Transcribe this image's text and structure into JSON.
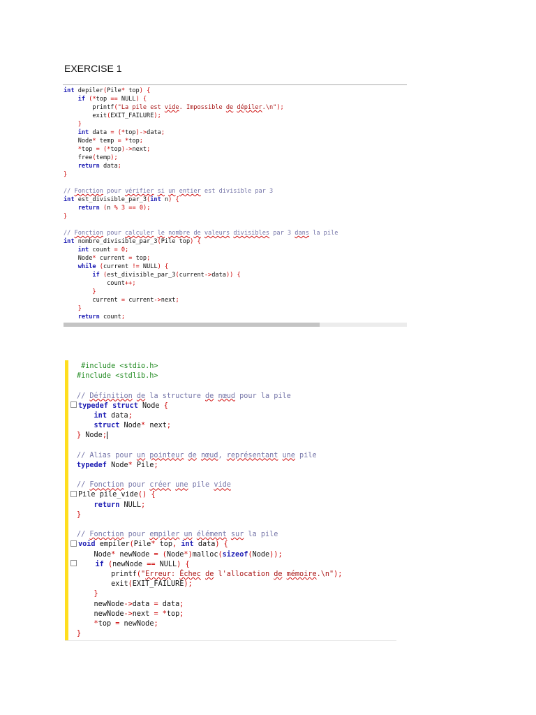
{
  "page": {
    "title": "EXERCISE 1"
  },
  "snippet1": {
    "lines": [
      "int depiler(Pile* top) {",
      "    if (*top == NULL) {",
      "        printf(\"La pile est vide. Impossible de dépiler.\\n\");",
      "        exit(EXIT_FAILURE);",
      "    }",
      "    int data = (*top)->data;",
      "    Node* temp = *top;",
      "    *top = (*top)->next;",
      "    free(temp);",
      "    return data;",
      "}",
      "",
      "// Fonction pour vérifier si un entier est divisible par 3",
      "int est_divisible_par_3(int n) {",
      "    return (n % 3 == 0);",
      "}",
      "",
      "// Fonction pour calculer le nombre de valeurs divisibles par 3 dans la pile",
      "int nombre_divisible_par_3(Pile top) {",
      "    int count = 0;",
      "    Node* current = top;",
      "    while (current != NULL) {",
      "        if (est_divisible_par_3(current->data)) {",
      "            count++;",
      "        }",
      "        current = current->next;",
      "    }",
      "    return count;"
    ]
  },
  "snippet2": {
    "lines": [
      " #include <stdio.h>",
      "#include <stdlib.h>",
      "",
      "// Définition de la structure de nœud pour la pile",
      "typedef struct Node {",
      "    int data;",
      "    struct Node* next;",
      "} Node;",
      "",
      "// Alias pour un pointeur de nœud, représentant une pile",
      "typedef Node* Pile;",
      "",
      "// Fonction pour créer une pile vide",
      "Pile pile_vide() {",
      "    return NULL;",
      "}",
      "",
      "// Fonction pour empiler un élément sur la pile",
      "void empiler(Pile* top, int data) {",
      "    Node* newNode = (Node*)malloc(sizeof(Node));",
      "    if (newNode == NULL) {",
      "        printf(\"Erreur: Échec de l'allocation de mémoire.\\n\");",
      "        exit(EXIT_FAILURE);",
      "    }",
      "    newNode->data = data;",
      "    newNode->next = *top;",
      "    *top = newNode;",
      "}"
    ]
  }
}
